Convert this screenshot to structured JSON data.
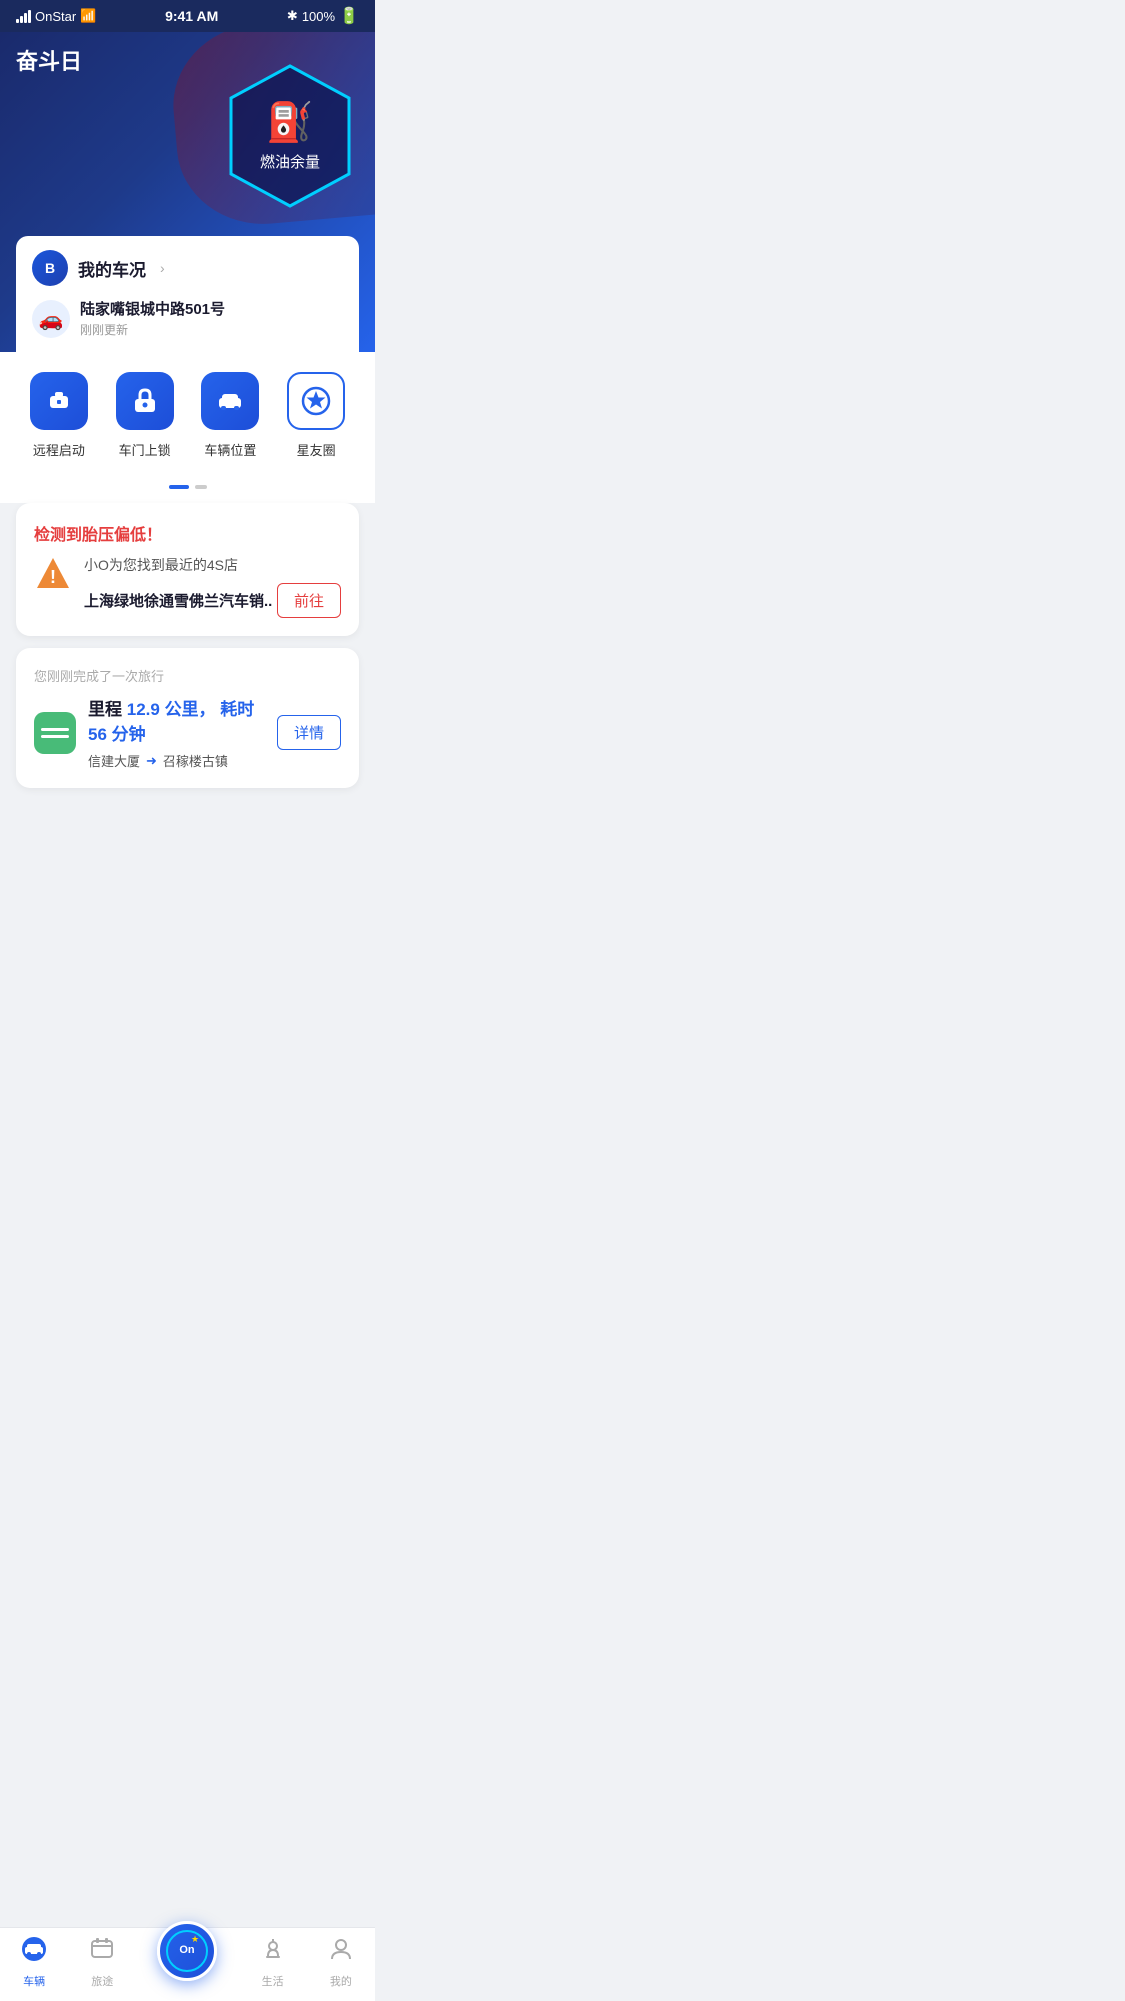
{
  "statusBar": {
    "carrier": "OnStar",
    "time": "9:41 AM",
    "battery": "100%"
  },
  "hero": {
    "title": "奋斗日",
    "badge": {
      "icon": "⛽",
      "label": "燃油余量"
    }
  },
  "carStatus": {
    "title": "我的车况",
    "location": "陆家嘴银城中路501号",
    "updated": "刚刚更新"
  },
  "actions": [
    {
      "id": "remote-start",
      "icon": "📦",
      "label": "远程启动"
    },
    {
      "id": "door-lock",
      "icon": "🔒",
      "label": "车门上锁"
    },
    {
      "id": "car-position",
      "icon": "🚗",
      "label": "车辆位置"
    },
    {
      "id": "star-circle",
      "icon": "⭐",
      "label": "星友圈"
    }
  ],
  "alertCard": {
    "title": "检测到胎压偏低！",
    "sub": "小O为您找到最近的4S店",
    "shopName": "上海绿地徐通雪佛兰汽车销..",
    "btnLabel": "前往"
  },
  "tripCard": {
    "subtitle": "您刚刚完成了一次旅行",
    "distance": "12.9",
    "distanceUnit": "公里，",
    "timeLabel": "耗时",
    "duration": "56",
    "durationUnit": "分钟",
    "from": "信建大厦",
    "to": "召稼楼古镇",
    "btnLabel": "详情"
  },
  "tabBar": {
    "tabs": [
      {
        "id": "vehicle",
        "icon": "🚗",
        "label": "车辆",
        "active": true
      },
      {
        "id": "trip",
        "icon": "💼",
        "label": "旅途",
        "active": false
      },
      {
        "id": "center",
        "icon": "On",
        "label": "",
        "active": false
      },
      {
        "id": "life",
        "icon": "☕",
        "label": "生活",
        "active": false
      },
      {
        "id": "mine",
        "icon": "👤",
        "label": "我的",
        "active": false
      }
    ]
  }
}
